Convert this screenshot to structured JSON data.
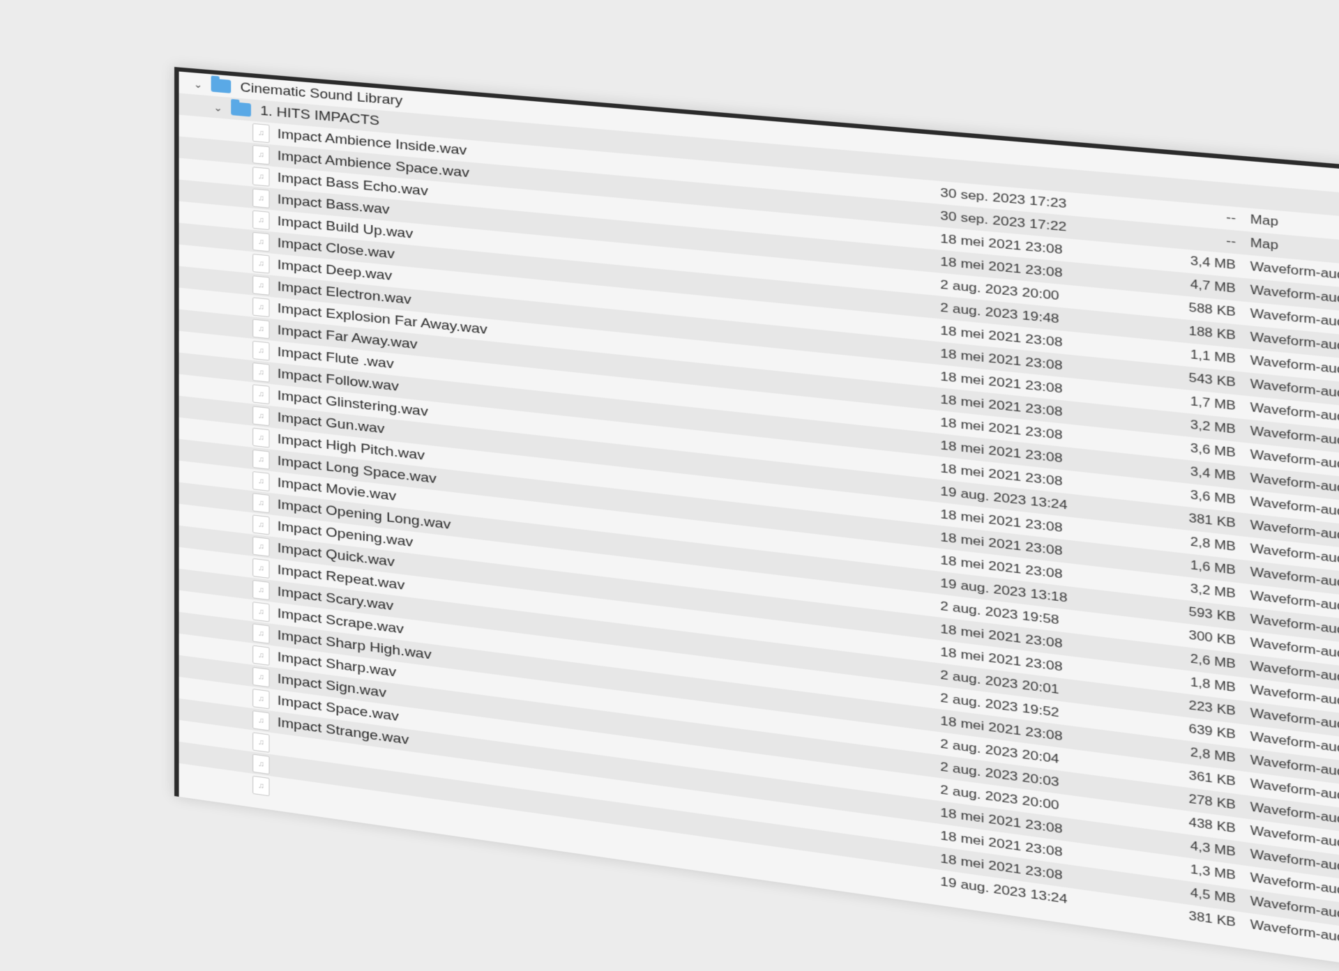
{
  "tree": {
    "root": {
      "name": "Cinematic Sound Library",
      "icon": "folder-icon",
      "expander": "chevron-down-icon"
    },
    "folder": {
      "name": "1. HITS IMPACTS",
      "icon": "folder-icon",
      "expander": "chevron-down-icon"
    },
    "files": [
      {
        "name": "Impact Ambience Inside.wav",
        "date": "30 sep. 2023 17:23",
        "size": "--",
        "kind": "Map"
      },
      {
        "name": "Impact Ambience Space.wav",
        "date": "30 sep. 2023 17:22",
        "size": "--",
        "kind": "Map"
      },
      {
        "name": "Impact Bass Echo.wav",
        "date": "18 mei 2021 23:08",
        "size": "3,4 MB",
        "kind": "Waveform-audio"
      },
      {
        "name": "Impact Bass.wav",
        "date": "18 mei 2021 23:08",
        "size": "4,7 MB",
        "kind": "Waveform-audio"
      },
      {
        "name": "Impact Build Up.wav",
        "date": "2 aug. 2023 20:00",
        "size": "588 KB",
        "kind": "Waveform-audio"
      },
      {
        "name": "Impact Close.wav",
        "date": "2 aug. 2023 19:48",
        "size": "188 KB",
        "kind": "Waveform-audio"
      },
      {
        "name": "Impact Deep.wav",
        "date": "18 mei 2021 23:08",
        "size": "1,1 MB",
        "kind": "Waveform-audio"
      },
      {
        "name": "Impact Electron.wav",
        "date": "18 mei 2021 23:08",
        "size": "543 KB",
        "kind": "Waveform-audio"
      },
      {
        "name": "Impact Explosion Far Away.wav",
        "date": "18 mei 2021 23:08",
        "size": "1,7 MB",
        "kind": "Waveform-audio"
      },
      {
        "name": "Impact Far Away.wav",
        "date": "18 mei 2021 23:08",
        "size": "3,2 MB",
        "kind": "Waveform-audio"
      },
      {
        "name": "Impact Flute .wav",
        "date": "18 mei 2021 23:08",
        "size": "3,6 MB",
        "kind": "Waveform-audio"
      },
      {
        "name": "Impact Follow.wav",
        "date": "18 mei 2021 23:08",
        "size": "3,4 MB",
        "kind": "Waveform-audio"
      },
      {
        "name": "Impact Glinstering.wav",
        "date": "18 mei 2021 23:08",
        "size": "3,6 MB",
        "kind": "Waveform-audio"
      },
      {
        "name": "Impact Gun.wav",
        "date": "19 aug. 2023 13:24",
        "size": "381 KB",
        "kind": "Waveform-audio"
      },
      {
        "name": "Impact High Pitch.wav",
        "date": "18 mei 2021 23:08",
        "size": "2,8 MB",
        "kind": "Waveform-audio"
      },
      {
        "name": "Impact Long Space.wav",
        "date": "18 mei 2021 23:08",
        "size": "1,6 MB",
        "kind": "Waveform-audio"
      },
      {
        "name": "Impact Movie.wav",
        "date": "18 mei 2021 23:08",
        "size": "3,2 MB",
        "kind": "Waveform-audio"
      },
      {
        "name": "Impact Opening Long.wav",
        "date": "19 aug. 2023 13:18",
        "size": "593 KB",
        "kind": "Waveform-audio"
      },
      {
        "name": "Impact Opening.wav",
        "date": "2 aug. 2023 19:58",
        "size": "300 KB",
        "kind": "Waveform-audio"
      },
      {
        "name": "Impact Quick.wav",
        "date": "18 mei 2021 23:08",
        "size": "2,6 MB",
        "kind": "Waveform-audio"
      },
      {
        "name": "Impact Repeat.wav",
        "date": "18 mei 2021 23:08",
        "size": "1,8 MB",
        "kind": "Waveform-audio"
      },
      {
        "name": "Impact Scary.wav",
        "date": "2 aug. 2023 20:01",
        "size": "223 KB",
        "kind": "Waveform-audio"
      },
      {
        "name": "Impact Scrape.wav",
        "date": "2 aug. 2023 19:52",
        "size": "639 KB",
        "kind": "Waveform-audio"
      },
      {
        "name": "Impact Sharp High.wav",
        "date": "18 mei 2021 23:08",
        "size": "2,8 MB",
        "kind": "Waveform-audio"
      },
      {
        "name": "Impact Sharp.wav",
        "date": "2 aug. 2023 20:04",
        "size": "361 KB",
        "kind": "Waveform-audio"
      },
      {
        "name": "Impact Sign.wav",
        "date": "2 aug. 2023 20:03",
        "size": "278 KB",
        "kind": "Waveform-audio"
      },
      {
        "name": "Impact Space.wav",
        "date": "2 aug. 2023 20:00",
        "size": "438 KB",
        "kind": "Waveform-audio"
      },
      {
        "name": "Impact Strange.wav",
        "date": "18 mei 2021 23:08",
        "size": "4,3 MB",
        "kind": "Waveform-audio"
      },
      {
        "name": "",
        "date": "18 mei 2021 23:08",
        "size": "1,3 MB",
        "kind": "Waveform-audio"
      },
      {
        "name": "",
        "date": "18 mei 2021 23:08",
        "size": "4,5 MB",
        "kind": "Waveform-audio"
      },
      {
        "name": "",
        "date": "19 aug. 2023 13:24",
        "size": "381 KB",
        "kind": "Waveform-audio"
      }
    ]
  },
  "colors": {
    "folder": "#5aa9e6",
    "background": "#ececec",
    "row_alt": "#e7e7e7"
  }
}
